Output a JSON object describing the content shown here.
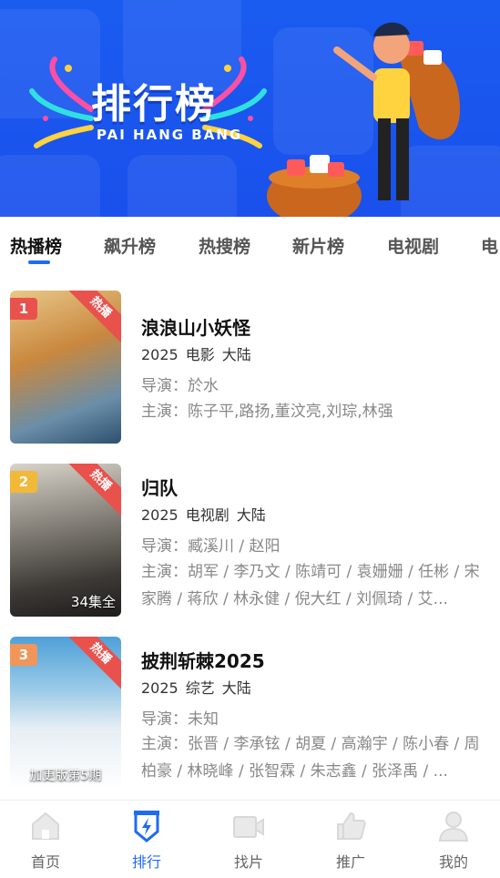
{
  "banner": {
    "title": "排行榜",
    "subtitle": "PAI HANG BANG"
  },
  "tabs": [
    "热播榜",
    "飙升榜",
    "热搜榜",
    "新片榜",
    "电视剧",
    "电"
  ],
  "active_tab": 0,
  "hot_label": "热播",
  "items": [
    {
      "rank": "1",
      "rank_color": "#e9514d",
      "title": "浪浪山小妖怪",
      "year": "2025",
      "category": "电影",
      "region": "大陆",
      "director": "导演：於水",
      "cast": "主演：陈子平,路扬,董汶亮,刘琮,林强",
      "poster_caption": ""
    },
    {
      "rank": "2",
      "rank_color": "#f2b838",
      "title": "归队",
      "year": "2025",
      "category": "电视剧",
      "region": "大陆",
      "director": "导演：臧溪川 / 赵阳",
      "cast": "主演：胡军 / 李乃文 / 陈靖可 / 袁姗姗 / 任彬 / 宋家腾 / 蒋欣 / 林永健 / 倪大红 / 刘佩琦 / 艾...",
      "poster_caption": "34集全"
    },
    {
      "rank": "3",
      "rank_color": "#f0965a",
      "title": "披荆斩棘2025",
      "year": "2025",
      "category": "综艺",
      "region": "大陆",
      "director": "导演：未知",
      "cast": "主演：张晋 / 李承铉 / 胡夏 / 高瀚宇 / 陈小春 / 周柏豪 / 林晓峰 / 张智霖 / 朱志鑫 / 张泽禹 / ...",
      "poster_caption": "加更版第5期"
    }
  ],
  "nav": [
    {
      "label": "首页",
      "icon": "home-icon"
    },
    {
      "label": "排行",
      "icon": "ranking-icon"
    },
    {
      "label": "找片",
      "icon": "video-camera-icon"
    },
    {
      "label": "推广",
      "icon": "thumbs-up-icon"
    },
    {
      "label": "我的",
      "icon": "user-icon"
    }
  ],
  "active_nav": 1,
  "colors": {
    "accent": "#1f6bf2",
    "banner": "#1a5cf0",
    "hot": "#e9514d"
  }
}
